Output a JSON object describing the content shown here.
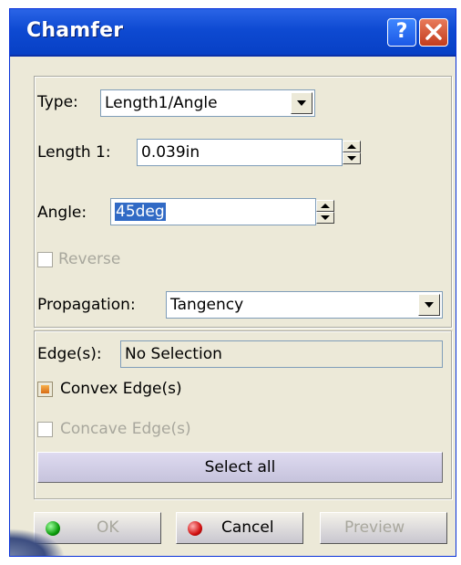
{
  "window": {
    "title": "Chamfer"
  },
  "icons": {
    "help": "help-icon",
    "close": "close-icon",
    "ok": "green-dot-icon",
    "cancel": "red-dot-icon"
  },
  "form": {
    "type": {
      "label": "Type:",
      "value": "Length1/Angle"
    },
    "length1": {
      "label": "Length 1:",
      "value": "0.039in"
    },
    "angle": {
      "label": "Angle:",
      "value": "45deg"
    },
    "reverse": {
      "label": "Reverse",
      "checked": false,
      "enabled": false
    },
    "propagation": {
      "label": "Propagation:",
      "value": "Tangency"
    }
  },
  "edges": {
    "label": "Edge(s):",
    "value": "No Selection",
    "convex": {
      "label": "Convex Edge(s)",
      "checked": true,
      "enabled": true
    },
    "concave": {
      "label": "Concave Edge(s)",
      "checked": false,
      "enabled": false
    },
    "select_all": "Select all"
  },
  "buttons": {
    "ok": "OK",
    "cancel": "Cancel",
    "preview": "Preview"
  },
  "colors": {
    "titlebar": "#0e4ad2",
    "dialog_bg": "#ece9d8",
    "selection": "#316ac5"
  }
}
